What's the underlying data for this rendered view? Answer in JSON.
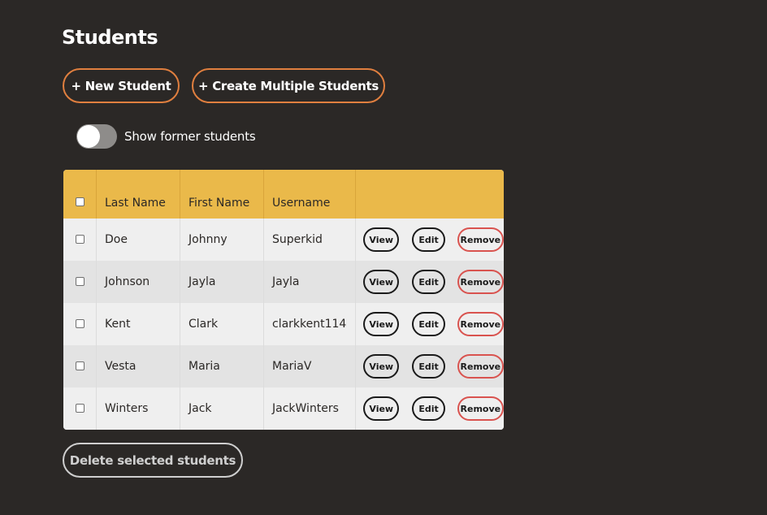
{
  "page": {
    "title": "Students"
  },
  "toolbar": {
    "new_student_label": "+ New Student",
    "create_multiple_label": "+ Create Multiple Students"
  },
  "toggle": {
    "label": "Show former students",
    "checked": false
  },
  "table": {
    "columns": [
      "Last Name",
      "First Name",
      "Username"
    ],
    "actions": {
      "view": "View",
      "edit": "Edit",
      "remove": "Remove"
    },
    "rows": [
      {
        "last_name": "Doe",
        "first_name": "Johnny",
        "username": "Superkid"
      },
      {
        "last_name": "Johnson",
        "first_name": "Jayla",
        "username": "Jayla"
      },
      {
        "last_name": "Kent",
        "first_name": "Clark",
        "username": "clarkkent114"
      },
      {
        "last_name": "Vesta",
        "first_name": "Maria",
        "username": "MariaV"
      },
      {
        "last_name": "Winters",
        "first_name": "Jack",
        "username": "JackWinters"
      }
    ]
  },
  "footer": {
    "delete_selected_label": "Delete selected students"
  },
  "colors": {
    "background": "#2b2826",
    "accent_orange": "#e07f3f",
    "header_yellow": "#eab94a",
    "remove_red": "#d9534f"
  }
}
